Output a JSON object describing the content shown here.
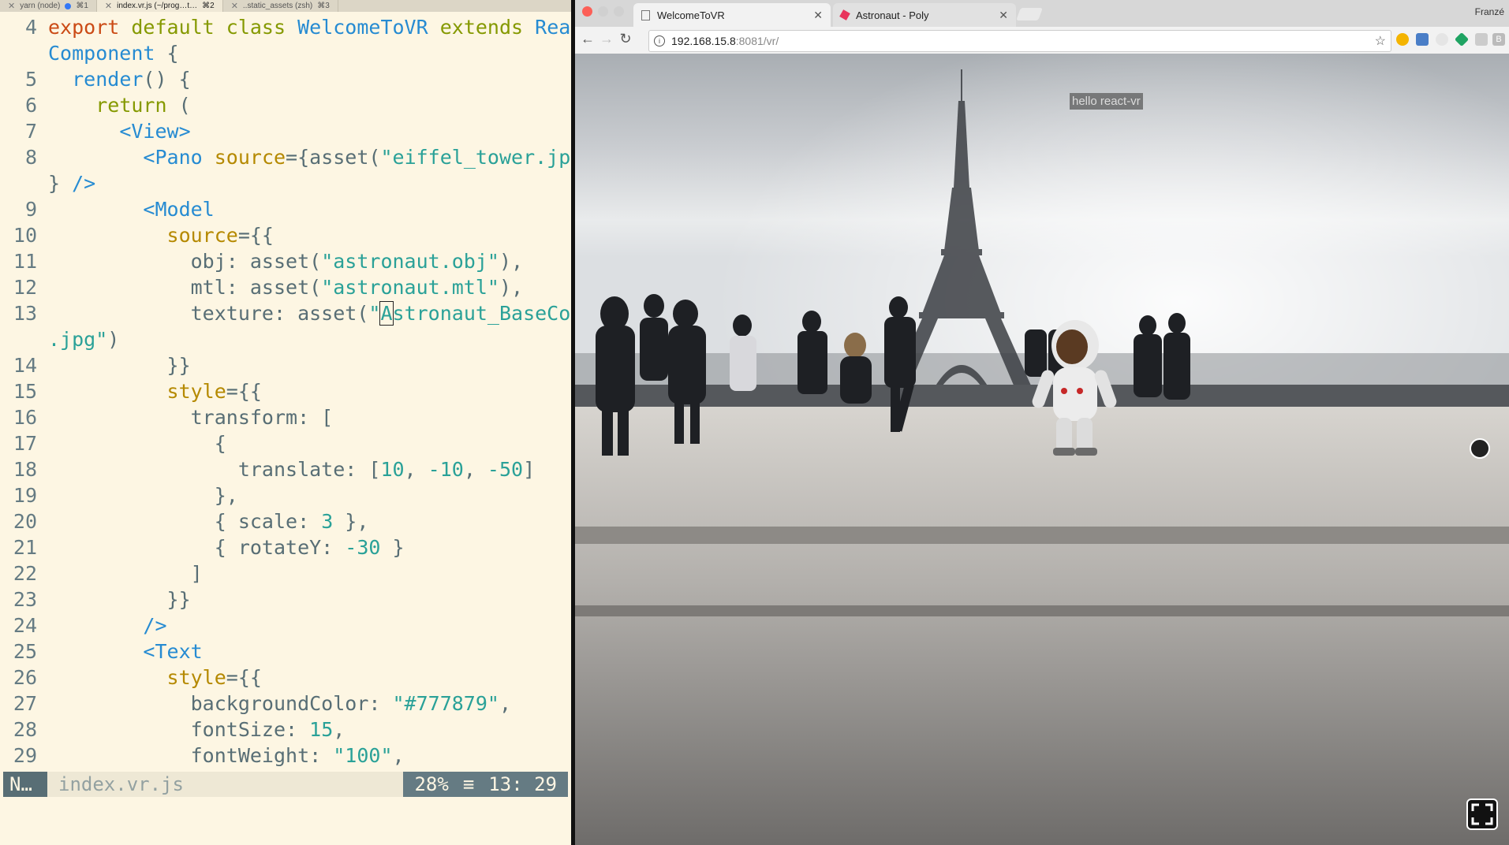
{
  "tmux": {
    "tabs": [
      {
        "label": "yarn (node)",
        "shortcut": "⌘1"
      },
      {
        "label": "index.vr.js (~/prog…t…",
        "shortcut": "⌘2"
      },
      {
        "label": "..static_assets (zsh)",
        "shortcut": "⌘3"
      }
    ]
  },
  "editor": {
    "lines": [
      {
        "n": "4",
        "tokens": [
          [
            "kw",
            "export "
          ],
          [
            "kw2",
            "default "
          ],
          [
            "kw2",
            "class "
          ],
          [
            "cls",
            "WelcomeToVR "
          ],
          [
            "kw2",
            "extends "
          ],
          [
            "cls",
            "React."
          ]
        ]
      },
      {
        "n": "",
        "tokens": [
          [
            "cls",
            "Component "
          ],
          [
            "plain",
            "{"
          ]
        ]
      },
      {
        "n": "5",
        "tokens": [
          [
            "plain",
            "  "
          ],
          [
            "cls",
            "render"
          ],
          [
            "plain",
            "() {"
          ]
        ]
      },
      {
        "n": "6",
        "tokens": [
          [
            "plain",
            "    "
          ],
          [
            "kw2",
            "return "
          ],
          [
            "plain",
            "("
          ]
        ]
      },
      {
        "n": "7",
        "tokens": [
          [
            "plain",
            "      "
          ],
          [
            "tag",
            "<View>"
          ]
        ]
      },
      {
        "n": "8",
        "tokens": [
          [
            "plain",
            "        "
          ],
          [
            "tag",
            "<Pano "
          ],
          [
            "attr",
            "source"
          ],
          [
            "plain",
            "={asset("
          ],
          [
            "str",
            "\"eiffel_tower.jpg\""
          ],
          [
            "plain",
            ")"
          ]
        ]
      },
      {
        "n": "",
        "tokens": [
          [
            "plain",
            "} "
          ],
          [
            "tag",
            "/>"
          ]
        ]
      },
      {
        "n": "9",
        "tokens": [
          [
            "plain",
            "        "
          ],
          [
            "tag",
            "<Model"
          ]
        ]
      },
      {
        "n": "10",
        "tokens": [
          [
            "plain",
            "          "
          ],
          [
            "attr",
            "source"
          ],
          [
            "plain",
            "={{"
          ]
        ]
      },
      {
        "n": "11",
        "tokens": [
          [
            "plain",
            "            obj: asset("
          ],
          [
            "str",
            "\"astronaut.obj\""
          ],
          [
            "plain",
            "),"
          ]
        ]
      },
      {
        "n": "12",
        "tokens": [
          [
            "plain",
            "            mtl: asset("
          ],
          [
            "str",
            "\"astronaut.mtl\""
          ],
          [
            "plain",
            "),"
          ]
        ]
      },
      {
        "n": "13",
        "tokens": [
          [
            "plain",
            "            texture: asset("
          ],
          [
            "str",
            "\""
          ],
          [
            "cursor",
            "A"
          ],
          [
            "str",
            "stronaut_BaseColor"
          ]
        ]
      },
      {
        "n": "",
        "tokens": [
          [
            "str",
            ".jpg\""
          ],
          [
            "plain",
            ")"
          ]
        ]
      },
      {
        "n": "14",
        "tokens": [
          [
            "plain",
            "          }}"
          ]
        ]
      },
      {
        "n": "15",
        "tokens": [
          [
            "plain",
            "          "
          ],
          [
            "attr",
            "style"
          ],
          [
            "plain",
            "={{"
          ]
        ]
      },
      {
        "n": "16",
        "tokens": [
          [
            "plain",
            "            transform: ["
          ]
        ]
      },
      {
        "n": "17",
        "tokens": [
          [
            "plain",
            "              {"
          ]
        ]
      },
      {
        "n": "18",
        "tokens": [
          [
            "plain",
            "                translate: ["
          ],
          [
            "num",
            "10"
          ],
          [
            "plain",
            ", "
          ],
          [
            "num",
            "-10"
          ],
          [
            "plain",
            ", "
          ],
          [
            "num",
            "-50"
          ],
          [
            "plain",
            "]"
          ]
        ]
      },
      {
        "n": "19",
        "tokens": [
          [
            "plain",
            "              },"
          ]
        ]
      },
      {
        "n": "20",
        "tokens": [
          [
            "plain",
            "              { scale: "
          ],
          [
            "num",
            "3"
          ],
          [
            "plain",
            " },"
          ]
        ]
      },
      {
        "n": "21",
        "tokens": [
          [
            "plain",
            "              { rotateY: "
          ],
          [
            "num",
            "-30"
          ],
          [
            "plain",
            " }"
          ]
        ]
      },
      {
        "n": "22",
        "tokens": [
          [
            "plain",
            "            ]"
          ]
        ]
      },
      {
        "n": "23",
        "tokens": [
          [
            "plain",
            "          }}"
          ]
        ]
      },
      {
        "n": "24",
        "tokens": [
          [
            "plain",
            "        "
          ],
          [
            "tag",
            "/>"
          ]
        ]
      },
      {
        "n": "25",
        "tokens": [
          [
            "plain",
            "        "
          ],
          [
            "tag",
            "<Text"
          ]
        ]
      },
      {
        "n": "26",
        "tokens": [
          [
            "plain",
            "          "
          ],
          [
            "attr",
            "style"
          ],
          [
            "plain",
            "={{"
          ]
        ]
      },
      {
        "n": "27",
        "tokens": [
          [
            "plain",
            "            backgroundColor: "
          ],
          [
            "str",
            "\"#777879\""
          ],
          [
            "plain",
            ","
          ]
        ]
      },
      {
        "n": "28",
        "tokens": [
          [
            "plain",
            "            fontSize: "
          ],
          [
            "num",
            "15"
          ],
          [
            "plain",
            ","
          ]
        ]
      },
      {
        "n": "29",
        "tokens": [
          [
            "plain",
            "            fontWeight: "
          ],
          [
            "str",
            "\"100\""
          ],
          [
            "plain",
            ","
          ]
        ]
      }
    ],
    "status": {
      "mode": "N…",
      "file": "index.vr.js",
      "percent": "28%",
      "menu_icon": "≡",
      "position": "13: 29"
    }
  },
  "browser": {
    "tabs": [
      {
        "title": "WelcomeToVR",
        "active": true
      },
      {
        "title": "Astronaut - Poly",
        "active": false
      }
    ],
    "user": "Franzé",
    "url_host": "192.168.15.8",
    "url_path": ":8081/vr/",
    "scene": {
      "label_text": "hello react-vr"
    }
  }
}
